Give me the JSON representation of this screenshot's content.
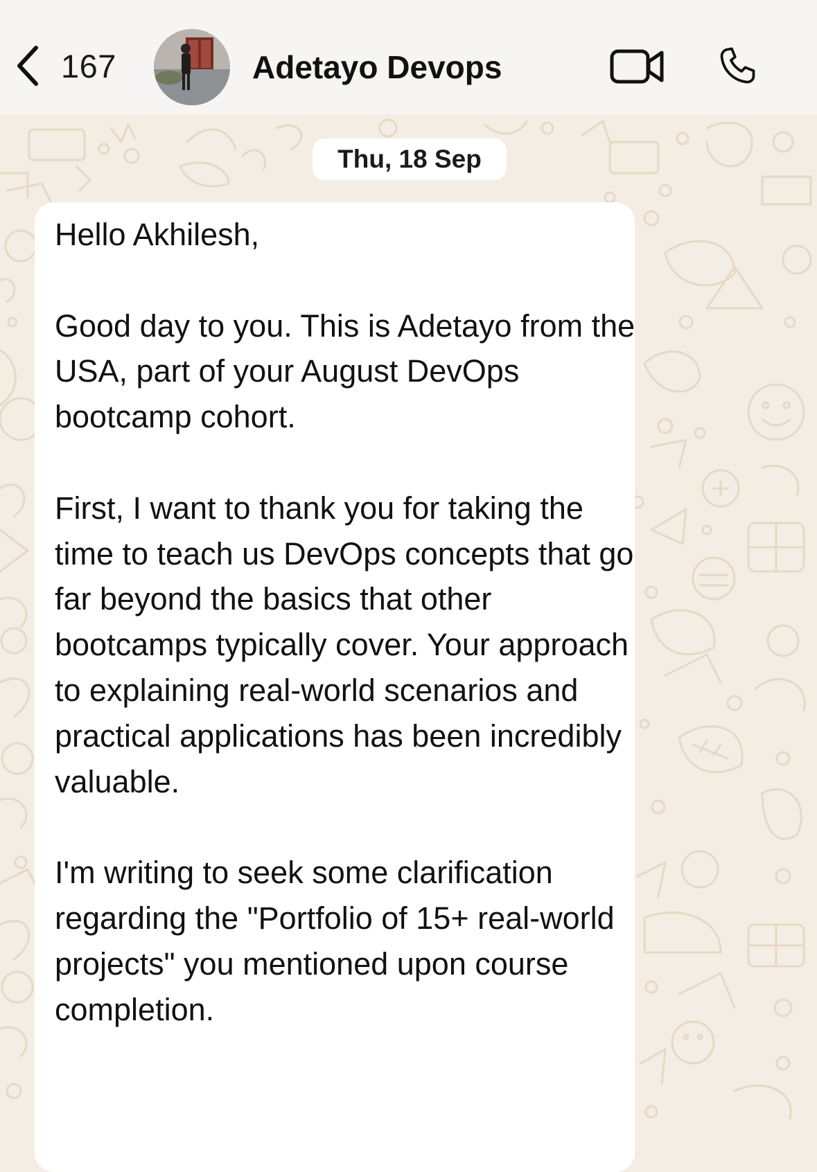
{
  "header": {
    "back_count": "167",
    "contact_name": "Adetayo Devops"
  },
  "chat": {
    "date_label": "Thu, 18 Sep",
    "message": {
      "paragraphs": [
        "Hello Akhilesh,",
        "Good day to you. This is Adetayo from the USA, part of your August DevOps bootcamp cohort.",
        "First, I want to thank you for taking the time to teach us DevOps concepts that go far beyond the basics that other bootcamps typically cover. Your approach to explaining real-world scenarios and practical applications has been incredibly valuable.",
        "I'm writing to seek some clarification regarding the \"Portfolio of 15+ real-world projects\" you mentioned upon course completion."
      ]
    }
  },
  "icons": {
    "back": "chevron-left-icon",
    "video": "video-camera-icon",
    "call": "phone-icon"
  },
  "colors": {
    "header_bg": "#f6f5f3",
    "wallpaper_bg": "#f3ede4",
    "doodle": "#e7d8c4",
    "bubble_bg": "#ffffff",
    "text": "#111111"
  }
}
